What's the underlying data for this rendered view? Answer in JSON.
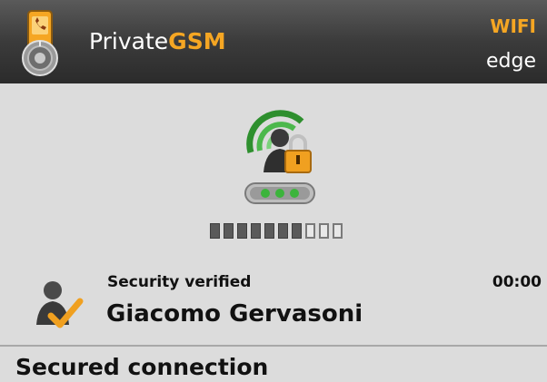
{
  "header": {
    "app_name_prefix": "Private",
    "app_name_brand": "GSM",
    "network_primary": "WIFI",
    "network_secondary": "edge"
  },
  "call": {
    "security_status": "Security verified",
    "timer": "00:00",
    "contact_name": "Giacomo Gervasoni",
    "connection_status": "Secured connection",
    "progress": {
      "filled_segments": 7,
      "total_segments": 10
    }
  },
  "colors": {
    "brand_orange": "#f5a623",
    "wifi_green": "#3caa3c",
    "lock_orange": "#f0a020",
    "check_orange": "#f0a020"
  },
  "icons": {
    "app": "app-logo-icon",
    "status": "secure-call-icon",
    "contact": "verified-contact-icon"
  }
}
